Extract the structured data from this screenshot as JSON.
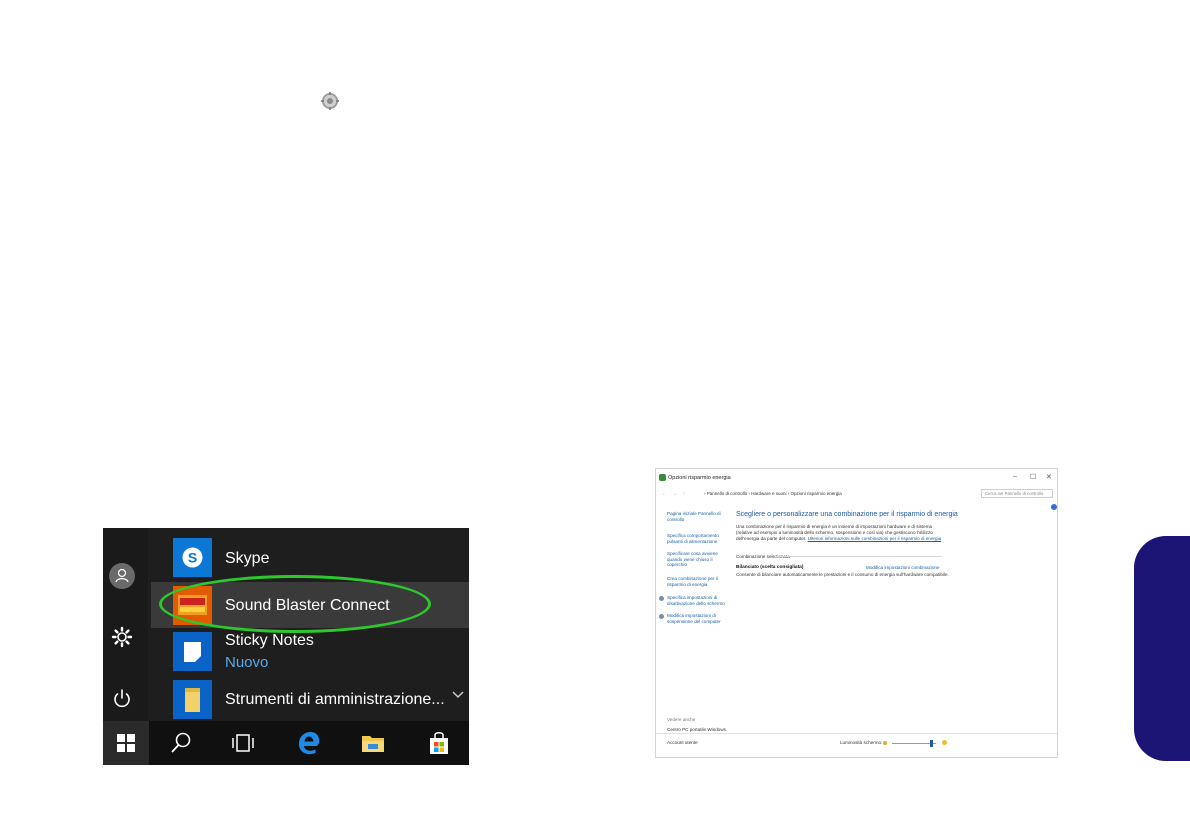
{
  "icons": {
    "top_gear": "gear-icon"
  },
  "start_menu": {
    "apps": [
      {
        "name": "Skype",
        "icon": "skype-icon",
        "tile_color": "#0a78d4"
      },
      {
        "name": "Sound Blaster Connect",
        "icon": "sound-blaster-icon",
        "tile_color": "#e35b00"
      },
      {
        "name": "Sticky Notes",
        "subtitle": "Nuovo",
        "icon": "sticky-notes-icon",
        "tile_color": "#0a64c8"
      },
      {
        "name": "Strumenti di amministrazione...",
        "icon": "folder-icon",
        "tile_color": "#0a64c8"
      }
    ],
    "highlight_color": "#2ec82e",
    "left_rail_icons": [
      "user-icon",
      "settings-icon",
      "power-icon"
    ],
    "taskbar_icons": [
      "windows-start-icon",
      "search-icon",
      "task-view-icon",
      "edge-icon",
      "file-explorer-icon",
      "store-icon"
    ]
  },
  "control_panel": {
    "title": "Opzioni risparmio energia",
    "breadcrumb": "› Pannello di controllo › Hardware e suoni › Opzioni risparmio energia",
    "search_placeholder": "Cerca nel Pannello di controllo",
    "window_buttons": [
      "–",
      "☐",
      "✕"
    ],
    "sidebar": [
      "Pagina iniziale Pannello di controllo",
      "Specifica comportamento pulsanti di alimentazione",
      "Specificare cosa avviene quando viene chiuso il coperchio",
      "Crea combinazione per il risparmio di energia",
      "Specifica impostazioni di disattivazione dello schermo",
      "Modifica impostazioni di sospensione del computer"
    ],
    "heading": "Scegliere o personalizzare una combinazione per il risparmio di energia",
    "description": "Una combinazione per il risparmio di energia è un insieme di impostazioni hardware e di sistema (relative ad esempio a luminosità dello schermo, sospensione e così via) che gestiscono l'utilizzo dell'energia da parte del computer.",
    "description_link": "Ulteriori informazioni sulle combinazioni per il risparmio di energia",
    "section_label": "Combinazione selezionata",
    "plan_name": "Bilanciato (scelta consigliata)",
    "plan_modify": "Modifica impostazioni combinazione",
    "plan_description": "Consente di bilanciare automaticamente le prestazioni e il consumo di energia sull'hardware compatibile.",
    "see_also": "Vedere anche",
    "see_also_links": [
      "Centro PC portatile Windows",
      "Account utente"
    ],
    "brightness_label": "Luminosità schermo:",
    "brightness_level": 0.9
  },
  "side_tab_color": "#1c1575"
}
